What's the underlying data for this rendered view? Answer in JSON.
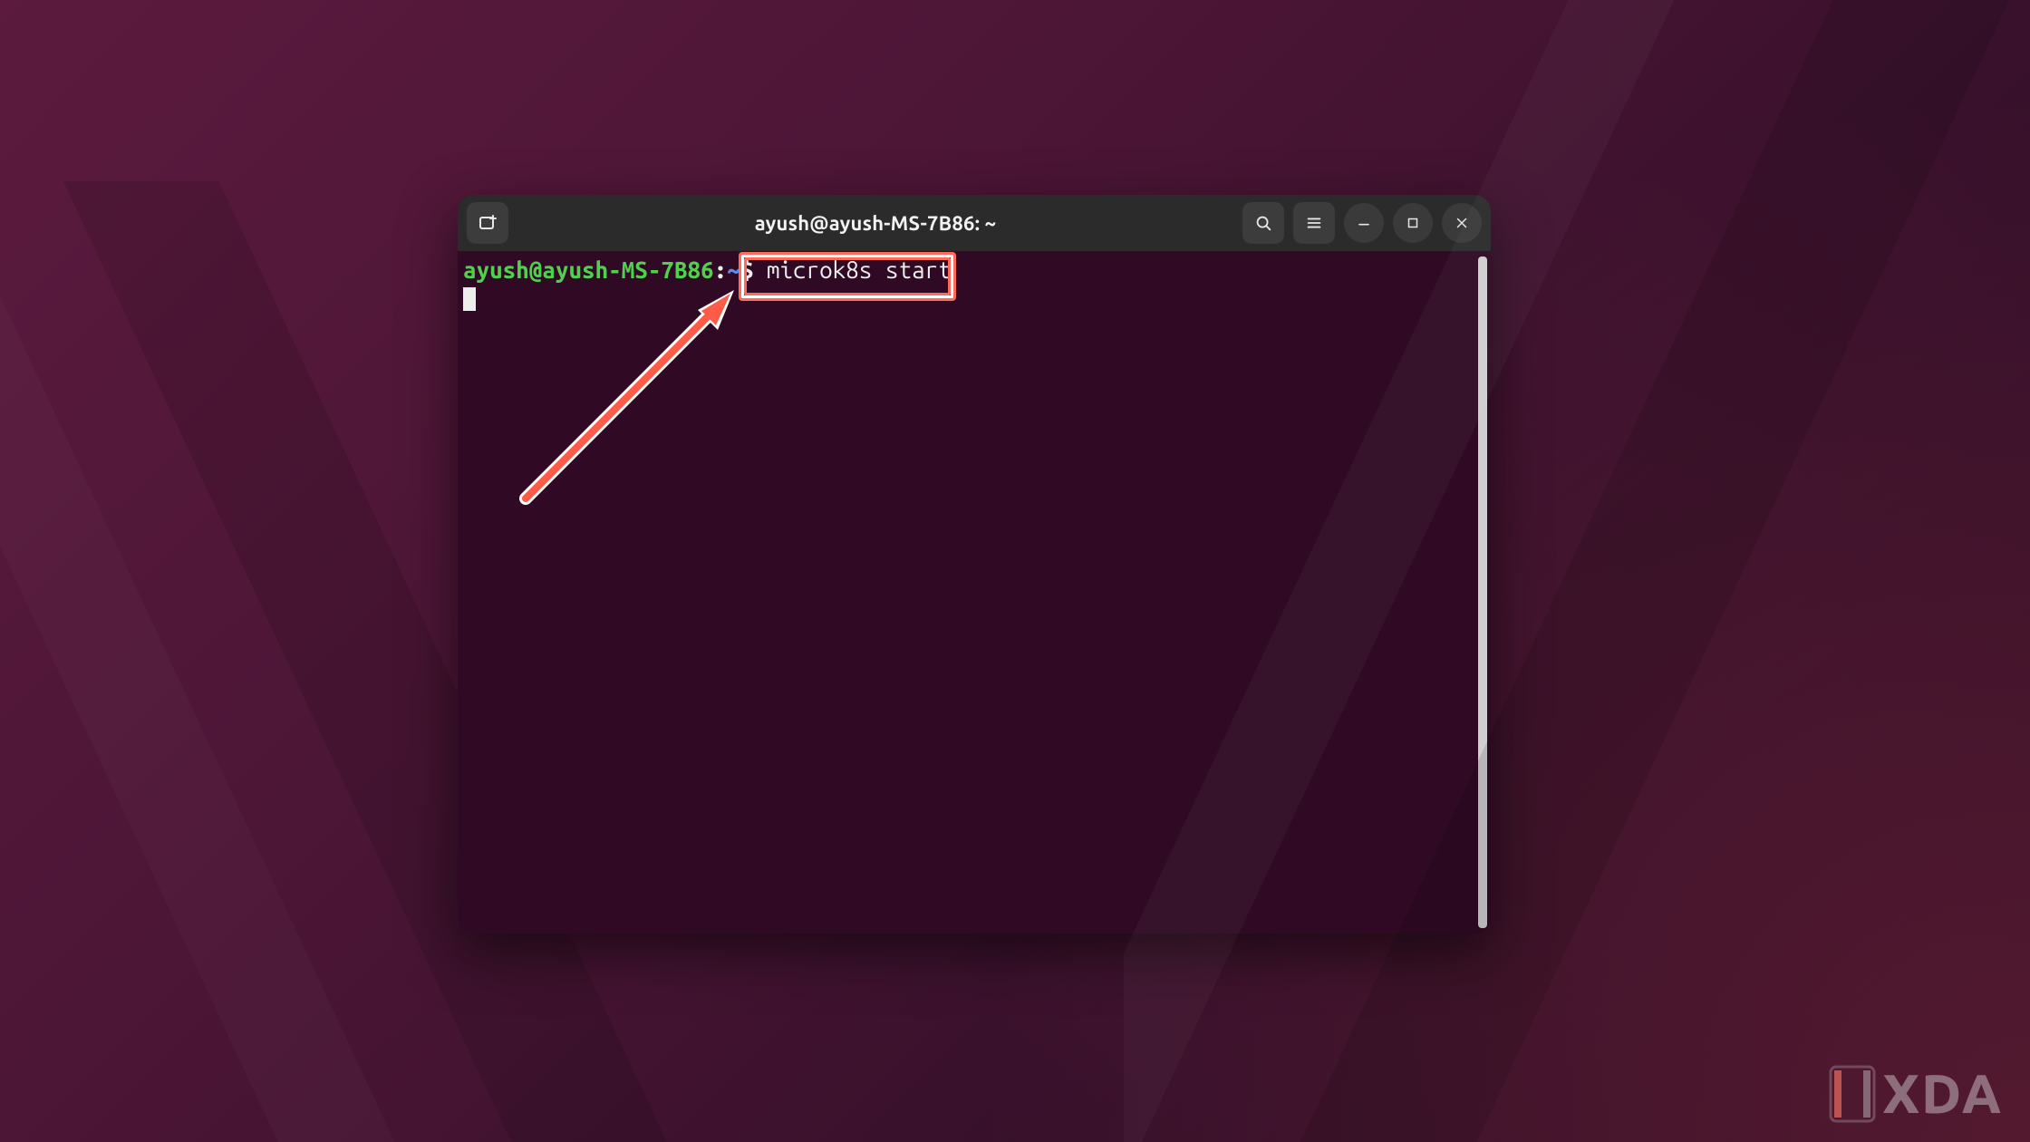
{
  "window": {
    "title": "ayush@ayush-MS-7B86: ~"
  },
  "titlebar": {
    "new_tab_icon": "new-tab-icon",
    "search_icon": "search-icon",
    "menu_icon": "hamburger-menu-icon",
    "minimize_icon": "minimize-icon",
    "maximize_icon": "maximize-icon",
    "close_icon": "close-icon"
  },
  "prompt": {
    "user_host": "ayush@ayush-MS-7B86",
    "separator": ":",
    "path": "~",
    "symbol": "$"
  },
  "command": "microk8s start",
  "annotation": {
    "highlighted_command": "microk8s start"
  },
  "watermark": {
    "text": "XDA"
  },
  "colors": {
    "terminal_bg": "#300a24",
    "titlebar_bg": "#2b2b2b",
    "prompt_user": "#4fd14f",
    "prompt_path": "#5c8af0",
    "highlight_border": "#ff6a5a"
  }
}
